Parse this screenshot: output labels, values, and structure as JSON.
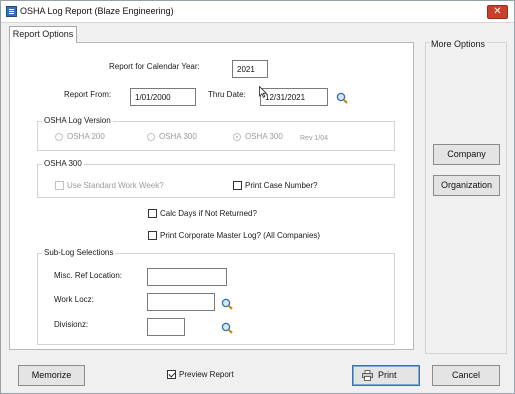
{
  "window": {
    "title": "OSHA Log Report (Blaze Engineering)",
    "close_glyph": "✕"
  },
  "tabs": [
    {
      "label": "Report Options"
    }
  ],
  "calendar_year": {
    "label": "Report for Calendar Year:",
    "value": "2021"
  },
  "report_from": {
    "label": "Report From:",
    "value": "1/01/2000"
  },
  "thru_date": {
    "label": "Thru Date:",
    "value": "12/31/2021"
  },
  "osha_log_version": {
    "title": "OSHA Log Version",
    "options": [
      {
        "label": "OSHA 200",
        "selected": false
      },
      {
        "label": "OSHA 300",
        "selected": false
      },
      {
        "label": "OSHA 300",
        "selected": true
      }
    ],
    "rev_note": "Rev 1/04"
  },
  "osha_300": {
    "title": "OSHA 300",
    "use_standard_work_week": {
      "label": "Use Standard Work Week?",
      "checked": false,
      "enabled": false
    },
    "print_case_number": {
      "label": "Print Case Number?",
      "checked": false,
      "enabled": true
    }
  },
  "calc_days": {
    "label": "Calc Days if Not Returned?",
    "checked": false
  },
  "print_corporate": {
    "label": "Print Corporate Master Log? (All Companies)",
    "checked": false
  },
  "sub_log": {
    "title": "Sub-Log Selections",
    "misc_ref_location": {
      "label": "Misc. Ref Location:",
      "value": ""
    },
    "work_locz": {
      "label": "Work Locz:",
      "value": ""
    },
    "divisionz": {
      "label": "Divisionz:",
      "value": ""
    }
  },
  "more_options": {
    "title": "More Options",
    "buttons": [
      {
        "label": "Company"
      },
      {
        "label": "Organization"
      }
    ]
  },
  "footer": {
    "memorize": "Memorize",
    "preview_report": {
      "label": "Preview Report",
      "checked": true
    },
    "print": "Print",
    "cancel": "Cancel"
  },
  "icons": {
    "lookup": "magnifier-icon",
    "print": "printer-icon",
    "app": "document-icon",
    "close": "close-icon"
  },
  "colors": {
    "close_button": "#c8402a",
    "default_button_border": "#3c6fb5",
    "lookup_icon": "#2f6fb0"
  }
}
